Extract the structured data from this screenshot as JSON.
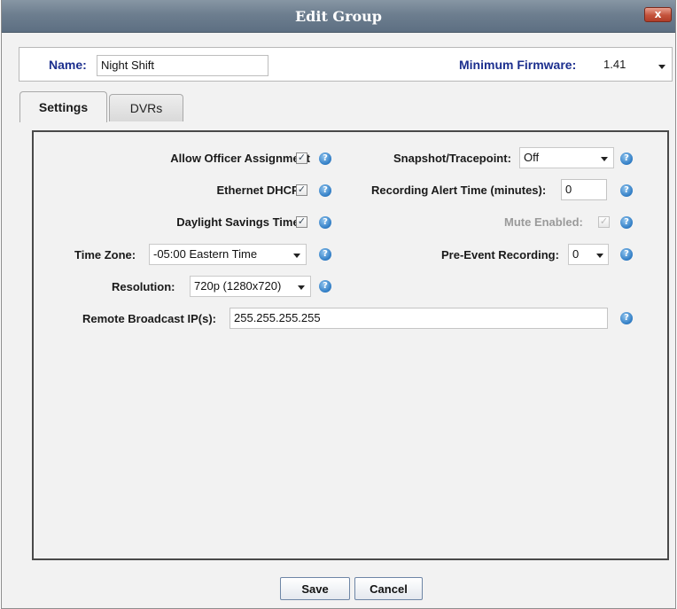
{
  "dialog": {
    "title": "Edit Group",
    "close_label": "x"
  },
  "header": {
    "name_label": "Name:",
    "name_value": "Night Shift",
    "firmware_label": "Minimum Firmware:",
    "firmware_value": "1.41"
  },
  "tabs": [
    {
      "label": "Settings",
      "active": true
    },
    {
      "label": "DVRs",
      "active": false
    }
  ],
  "settings": {
    "allow_officer_assignment": {
      "label": "Allow Officer Assignment",
      "checked": true
    },
    "ethernet_dhcp": {
      "label": "Ethernet DHCP:",
      "checked": true
    },
    "daylight_savings": {
      "label": "Daylight Savings Time:",
      "checked": true
    },
    "time_zone": {
      "label": "Time Zone:",
      "value": "-05:00 Eastern Time"
    },
    "resolution": {
      "label": "Resolution:",
      "value": "720p (1280x720)"
    },
    "remote_broadcast": {
      "label": "Remote Broadcast IP(s):",
      "value": "255.255.255.255"
    },
    "snapshot": {
      "label": "Snapshot/Tracepoint:",
      "value": "Off"
    },
    "recording_alert": {
      "label": "Recording Alert Time (minutes):",
      "value": "0"
    },
    "mute_enabled": {
      "label": "Mute Enabled:",
      "checked": true,
      "disabled": true
    },
    "pre_event": {
      "label": "Pre-Event Recording:",
      "value": "0"
    }
  },
  "buttons": {
    "save": "Save",
    "cancel": "Cancel"
  },
  "icons": {
    "help": "question-mark-icon",
    "check": "✓",
    "help_glyph": "?"
  },
  "colors": {
    "titlebar": "#6d7e8f",
    "label_blue": "#1c2f8e",
    "help_blue": "#2f7cc4",
    "close_red": "#c4533c"
  }
}
